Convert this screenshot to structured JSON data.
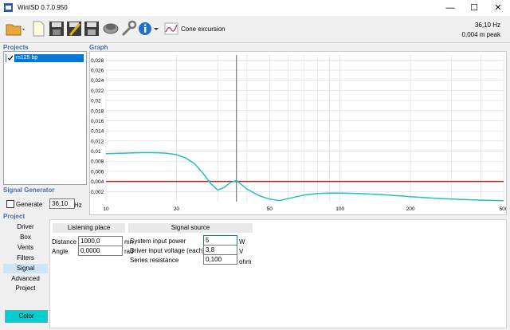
{
  "window": {
    "title": "WinISD 0.7.0.950",
    "minimize": "—",
    "maximize": "☐",
    "close": "✕"
  },
  "toolbar": {
    "cone_excursion_label": "Cone excursion",
    "freq_readout": "36,10 Hz",
    "peak_readout": "0,004 m peak"
  },
  "sections": {
    "projects": "Projects",
    "graph": "Graph",
    "signal_generator": "Signal Generator",
    "project": "Project"
  },
  "projects": [
    {
      "name": "rs125 bp",
      "checked": true
    }
  ],
  "signal_generator": {
    "generate_label": "Generate",
    "frequency": "36,10",
    "unit": "Hz"
  },
  "nav": [
    "Driver",
    "Box",
    "Vents",
    "Filters",
    "Signal",
    "Advanced",
    "Project"
  ],
  "nav_active": "Signal",
  "listening_place": {
    "header": "Listening place",
    "distance_label": "Distance",
    "distance_value": "1000,0",
    "distance_unit": "mn",
    "angle_label": "Angle",
    "angle_value": "0,0000",
    "angle_unit": "rad"
  },
  "signal_source": {
    "header": "Signal source",
    "power_label": "System input power",
    "power_value": "5",
    "power_unit": "W",
    "voltage_label": "Driver input voltage (each)",
    "voltage_value": "3,8",
    "voltage_unit": "V",
    "resistance_label": "Series resistance",
    "resistance_value": "0,100",
    "resistance_unit": "ohm"
  },
  "color_button": "Color",
  "chart_data": {
    "type": "line",
    "xscale": "log",
    "xlim": [
      10,
      500
    ],
    "ylim": [
      0,
      0.029
    ],
    "xticks": [
      10,
      20,
      50,
      100,
      200,
      500
    ],
    "xtick_labels": [
      "10",
      "20",
      "50",
      "100",
      "200",
      "500"
    ],
    "yticks": [
      0.002,
      0.004,
      0.006,
      0.008,
      0.01,
      0.012,
      0.014,
      0.016,
      0.018,
      0.02,
      0.022,
      0.024,
      0.026,
      0.028
    ],
    "ytick_labels": [
      "0,002",
      "0,004",
      "0,006",
      "0,008",
      "0,01",
      "0,012",
      "0,014",
      "0,016",
      "0,018",
      "0,02",
      "0,022",
      "0,024",
      "0,026",
      "0,028"
    ],
    "cursor_x": 36.1,
    "reference_y": 0.004,
    "colors": {
      "curve": "#20c0c0",
      "reference": "#a0301c",
      "cursor": "#606060",
      "grid": "#d8d8d8"
    },
    "series": [
      {
        "x": [
          10,
          12,
          14,
          16,
          18,
          20,
          22,
          24,
          26,
          28,
          30,
          32,
          34,
          36.1,
          40,
          45,
          50,
          55,
          60,
          70,
          80,
          90,
          100,
          120,
          150,
          200,
          250,
          300,
          400,
          500
        ],
        "y": [
          0.0095,
          0.0096,
          0.0097,
          0.0097,
          0.0096,
          0.0093,
          0.0086,
          0.0074,
          0.0056,
          0.0036,
          0.0023,
          0.0028,
          0.0038,
          0.0042,
          0.0025,
          0.0012,
          0.0005,
          0.0002,
          0.0006,
          0.0013,
          0.0016,
          0.0017,
          0.0017,
          0.0016,
          0.0014,
          0.001,
          0.0007,
          0.0005,
          0.0003,
          0.0002
        ]
      }
    ]
  }
}
